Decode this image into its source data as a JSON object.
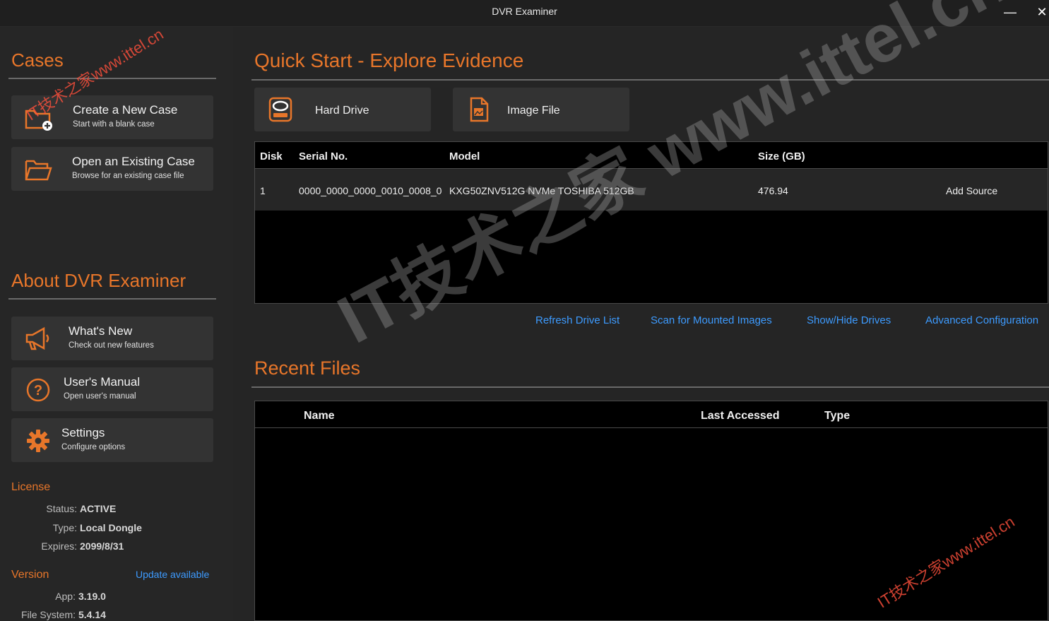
{
  "window": {
    "title": "DVR Examiner",
    "minimize_glyph": "—",
    "close_glyph": "✕"
  },
  "sidebar": {
    "cases_title": "Cases",
    "cases": [
      {
        "title": "Create a New Case",
        "subtitle": "Start with a blank case",
        "icon": "folder-plus-icon"
      },
      {
        "title": "Open an Existing Case",
        "subtitle": "Browse for an existing case file",
        "icon": "folder-open-icon"
      }
    ],
    "about_title": "About DVR Examiner",
    "about": [
      {
        "title": "What's New",
        "subtitle": "Check out new features",
        "icon": "megaphone-icon"
      },
      {
        "title": "User's Manual",
        "subtitle": "Open user's manual",
        "icon": "help-icon"
      },
      {
        "title": "Settings",
        "subtitle": "Configure options",
        "icon": "gear-icon"
      }
    ],
    "license": {
      "heading": "License",
      "status_label": "Status:",
      "status": "ACTIVE",
      "type_label": "Type:",
      "type": "Local Dongle",
      "expires_label": "Expires:",
      "expires": "2099/8/31"
    },
    "version": {
      "heading": "Version",
      "update_link": "Update available",
      "app_label": "App:",
      "app": "3.19.0",
      "fs_label": "File System:",
      "fs": "5.4.14"
    }
  },
  "main": {
    "quick_start_title": "Quick Start - Explore Evidence",
    "sources": [
      {
        "label": "Hard Drive",
        "icon": "hard-drive-icon"
      },
      {
        "label": "Image File",
        "icon": "image-file-icon"
      }
    ],
    "drives": {
      "columns": [
        "Disk",
        "Serial No.",
        "Model",
        "Size (GB)"
      ],
      "rows": [
        {
          "disk": "1",
          "serial": "0000_0000_0000_0010_0008_0",
          "model": "KXG50ZNV512G NVMe TOSHIBA 512GB",
          "size": "476.94",
          "action": "Add Source"
        }
      ]
    },
    "tools": [
      "Refresh Drive List",
      "Scan for Mounted Images",
      "Show/Hide Drives",
      "Advanced Configuration"
    ],
    "recent_title": "Recent Files",
    "recent": {
      "columns": [
        "Name",
        "Last Accessed",
        "Type"
      ],
      "rows": []
    }
  },
  "watermarks": {
    "big": "IT技术之家 www.ittel.cn",
    "small": "IT技术之家www.ittel.cn"
  },
  "colors": {
    "accent": "#e8762a",
    "link": "#3d9bff",
    "panel": "#333333",
    "background": "#252525"
  }
}
